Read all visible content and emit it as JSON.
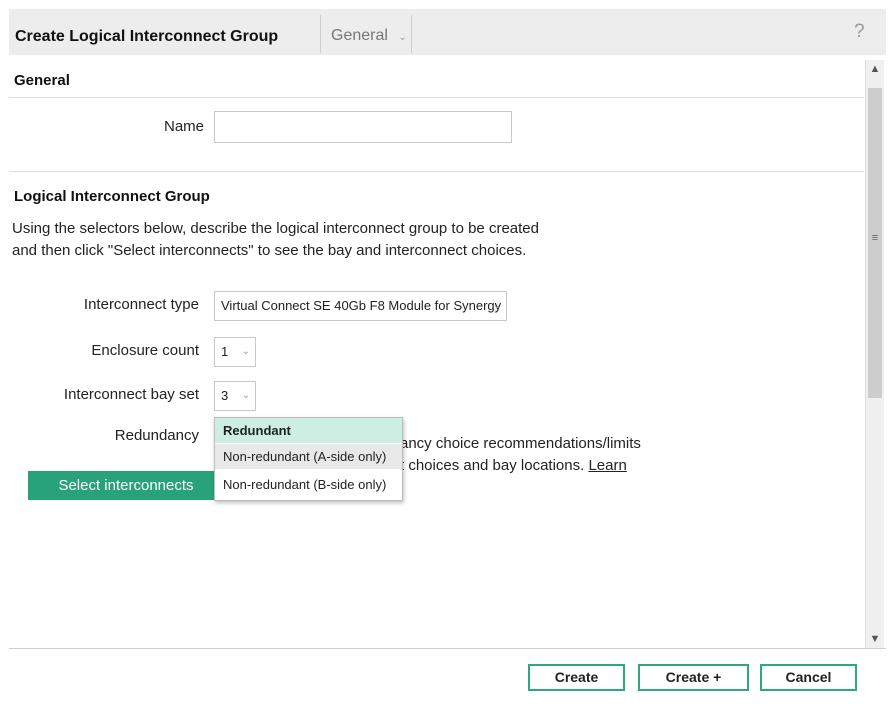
{
  "header": {
    "title": "Create Logical Interconnect Group",
    "nav_label": "General",
    "nav_chevron": "⌄",
    "help_glyph": "?"
  },
  "general": {
    "section_title": "General",
    "name_label": "Name",
    "name_value": ""
  },
  "lig": {
    "section_title": "Logical Interconnect Group",
    "description_line1": "Using the selectors below, describe the logical interconnect group to be created",
    "description_line2": "and then click \"Select interconnects\" to see the bay and interconnect choices.",
    "interconnect_type": {
      "label": "Interconnect type",
      "value": "Virtual Connect SE 40Gb F8 Module for Synergy"
    },
    "enclosure_count": {
      "label": "Enclosure count",
      "value": "1"
    },
    "bay_set": {
      "label": "Interconnect bay set",
      "value": "3"
    },
    "redundancy": {
      "label": "Redundancy",
      "options": [
        "Redundant",
        "Non-redundant (A-side only)",
        "Non-redundant (B-side only)"
      ],
      "help_line1_fragment": "ancy choice recommendations/limits",
      "help_line2_fragment": "t choices and bay locations.",
      "learn_link": "Learn"
    },
    "select_button": "Select interconnects"
  },
  "footer": {
    "create": "Create",
    "create_plus": "Create +",
    "cancel": "Cancel"
  },
  "colors": {
    "accent": "#28a27b",
    "dropdown_highlight": "#cdeee3",
    "dropdown_hover": "#e8e8e8"
  }
}
